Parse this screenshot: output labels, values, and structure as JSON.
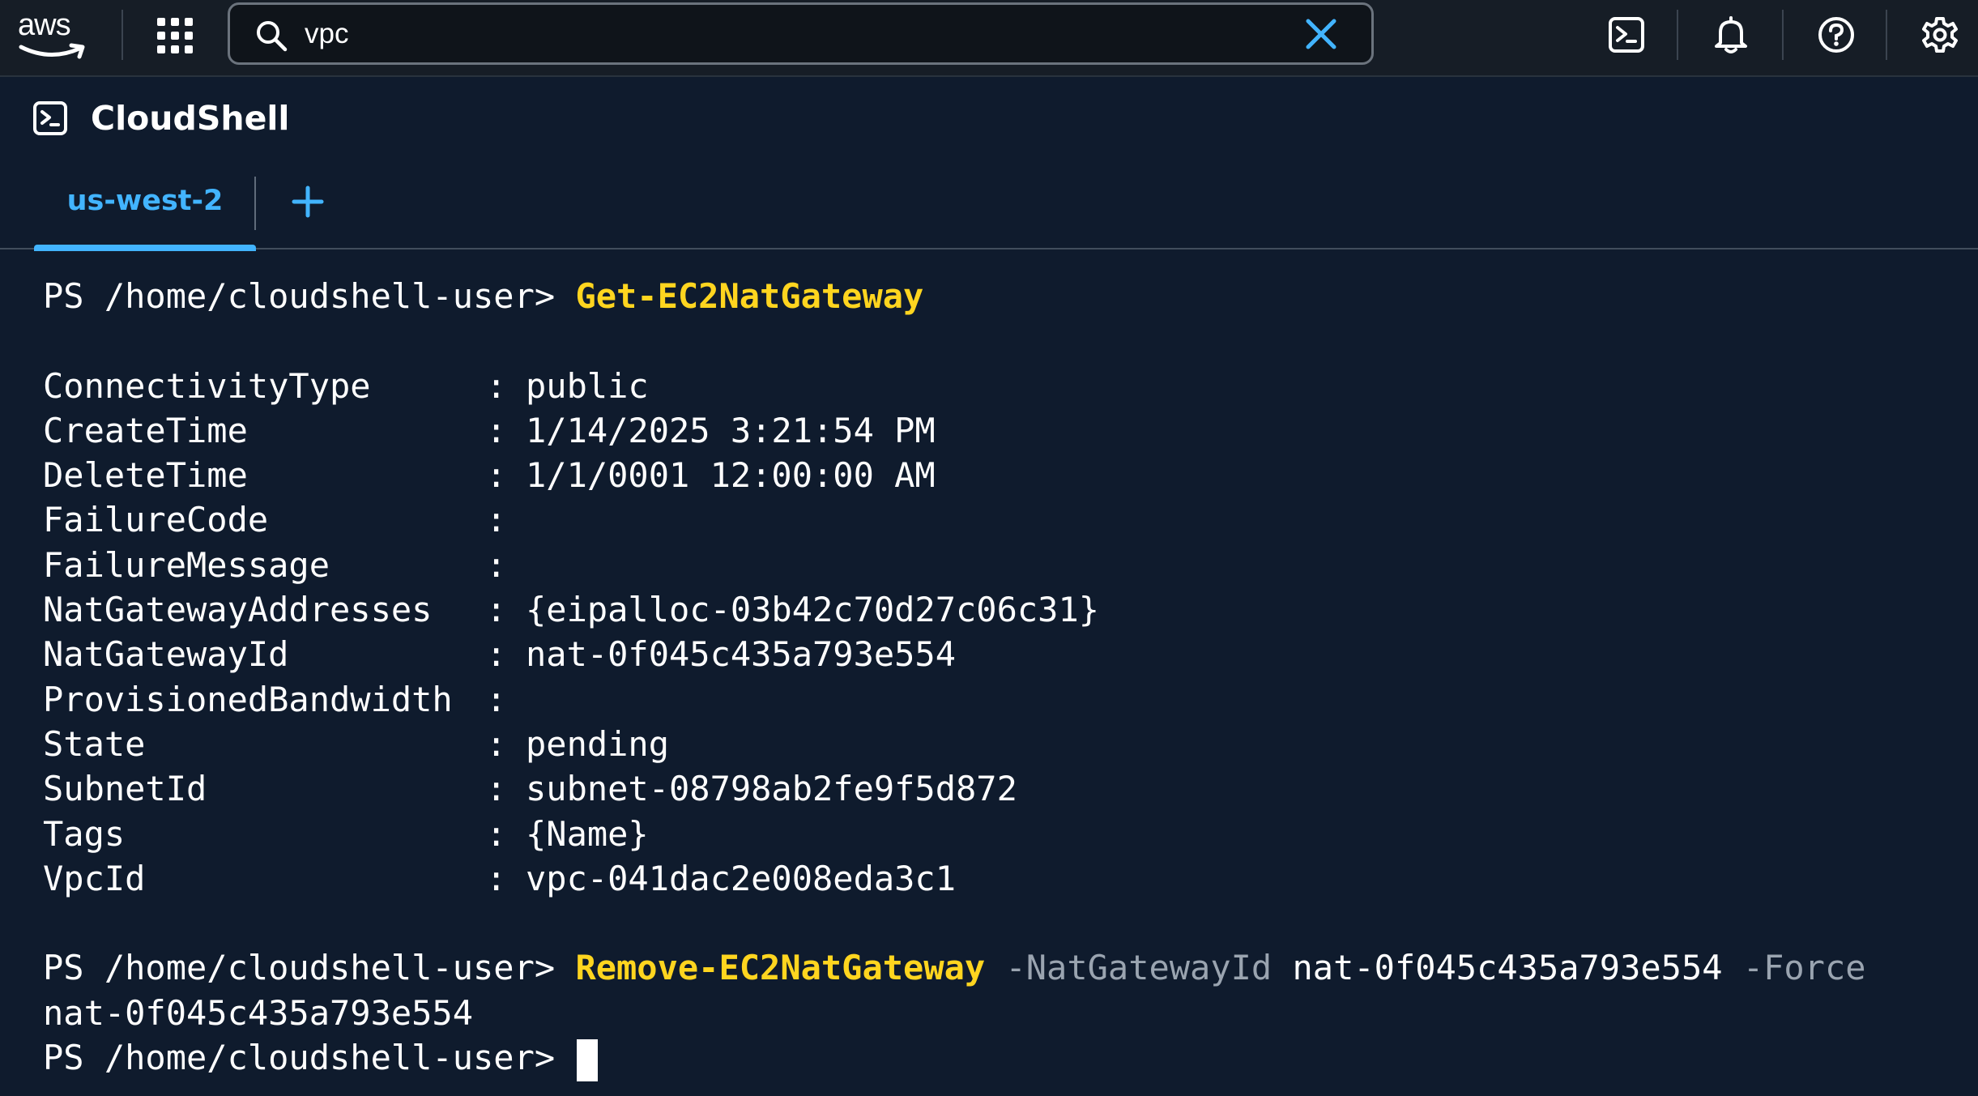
{
  "nav": {
    "brand": "aws",
    "search": {
      "value": "vpc",
      "placeholder": "Search"
    },
    "icons": [
      "grid-icon",
      "search-icon",
      "clear-icon",
      "cloudshell-icon",
      "bell-icon",
      "help-icon",
      "settings-icon"
    ]
  },
  "header": {
    "title": "CloudShell"
  },
  "tabs": [
    {
      "label": "us-west-2",
      "active": true
    }
  ],
  "terminal": {
    "prompt": "PS /home/cloudshell-user>",
    "command1": "Get-EC2NatGateway",
    "separator": ":",
    "properties": [
      {
        "key": "ConnectivityType",
        "value": "public"
      },
      {
        "key": "CreateTime",
        "value": "1/14/2025 3:21:54 PM"
      },
      {
        "key": "DeleteTime",
        "value": "1/1/0001 12:00:00 AM"
      },
      {
        "key": "FailureCode",
        "value": ""
      },
      {
        "key": "FailureMessage",
        "value": ""
      },
      {
        "key": "NatGatewayAddresses",
        "value": "{eipalloc-03b42c70d27c06c31}"
      },
      {
        "key": "NatGatewayId",
        "value": "nat-0f045c435a793e554"
      },
      {
        "key": "ProvisionedBandwidth",
        "value": ""
      },
      {
        "key": "State",
        "value": "pending"
      },
      {
        "key": "SubnetId",
        "value": "subnet-08798ab2fe9f5d872"
      },
      {
        "key": "Tags",
        "value": "{Name}"
      },
      {
        "key": "VpcId",
        "value": "vpc-041dac2e008eda3c1"
      }
    ],
    "command2": "Remove-EC2NatGateway",
    "command2_param1": "-NatGatewayId",
    "command2_arg1": "nat-0f045c435a793e554",
    "command2_param2": "-Force",
    "command2_output": "nat-0f045c435a793e554"
  },
  "colors": {
    "background": "#0f1b2d",
    "topnav": "#161d26",
    "accent": "#42b4ff",
    "command": "#ffd51f",
    "parameter": "#9aa4b0"
  }
}
